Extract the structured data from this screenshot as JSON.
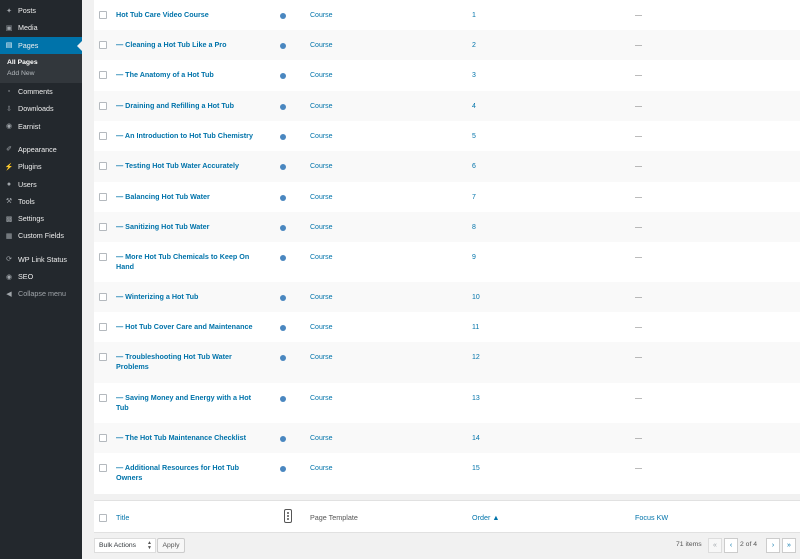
{
  "sidebar": {
    "items_top": [
      {
        "label": "Posts",
        "icon": "pin-icon"
      },
      {
        "label": "Media",
        "icon": "media-icon"
      },
      {
        "label": "Pages",
        "icon": "pages-icon"
      }
    ],
    "submenu": [
      {
        "label": "All Pages"
      },
      {
        "label": "Add New"
      }
    ],
    "items_mid": [
      {
        "label": "Comments",
        "icon": "comment-icon"
      },
      {
        "label": "Downloads",
        "icon": "download-icon"
      },
      {
        "label": "Earnist",
        "icon": "earnist-icon"
      }
    ],
    "items_bottom": [
      {
        "label": "Appearance",
        "icon": "brush-icon"
      },
      {
        "label": "Plugins",
        "icon": "plugin-icon"
      },
      {
        "label": "Users",
        "icon": "users-icon"
      },
      {
        "label": "Tools",
        "icon": "wrench-icon"
      },
      {
        "label": "Settings",
        "icon": "settings-icon"
      },
      {
        "label": "Custom Fields",
        "icon": "fields-icon"
      },
      {
        "label": "WP Link Status",
        "icon": "link-status-icon"
      },
      {
        "label": "SEO",
        "icon": "seo-icon"
      },
      {
        "label": "Collapse menu",
        "icon": "collapse-icon"
      }
    ]
  },
  "rows": [
    {
      "title": "Hot Tub Care Video Course",
      "template": "Course",
      "order": "1",
      "kw": "—"
    },
    {
      "title": "— Cleaning a Hot Tub Like a Pro",
      "template": "Course",
      "order": "2",
      "kw": "—"
    },
    {
      "title": "— The Anatomy of a Hot Tub",
      "template": "Course",
      "order": "3",
      "kw": "—"
    },
    {
      "title": "— Draining and Refilling a Hot Tub",
      "template": "Course",
      "order": "4",
      "kw": "—"
    },
    {
      "title": "— An Introduction to Hot Tub Chemistry",
      "template": "Course",
      "order": "5",
      "kw": "—"
    },
    {
      "title": "— Testing Hot Tub Water Accurately",
      "template": "Course",
      "order": "6",
      "kw": "—"
    },
    {
      "title": "— Balancing Hot Tub Water",
      "template": "Course",
      "order": "7",
      "kw": "—"
    },
    {
      "title": "— Sanitizing Hot Tub Water",
      "template": "Course",
      "order": "8",
      "kw": "—"
    },
    {
      "title": "— More Hot Tub Chemicals to Keep On Hand",
      "template": "Course",
      "order": "9",
      "kw": "—"
    },
    {
      "title": "— Winterizing a Hot Tub",
      "template": "Course",
      "order": "10",
      "kw": "—"
    },
    {
      "title": "— Hot Tub Cover Care and Maintenance",
      "template": "Course",
      "order": "11",
      "kw": "—"
    },
    {
      "title": "— Troubleshooting Hot Tub Water Problems",
      "template": "Course",
      "order": "12",
      "kw": "—"
    },
    {
      "title": "— Saving Money and Energy with a Hot Tub",
      "template": "Course",
      "order": "13",
      "kw": "—"
    },
    {
      "title": "— The Hot Tub Maintenance Checklist",
      "template": "Course",
      "order": "14",
      "kw": "—"
    },
    {
      "title": "— Additional Resources for Hot Tub Owners",
      "template": "Course",
      "order": "15",
      "kw": "—"
    }
  ],
  "footer_header": {
    "title": "Title",
    "page_template": "Page Template",
    "order": "Order ▲",
    "focus_kw": "Focus KW"
  },
  "bottom": {
    "bulk_actions": "Bulk Actions",
    "apply": "Apply",
    "items": "71 items",
    "first": "«",
    "prev": "‹",
    "page": "2 of 4",
    "next": "›",
    "last": "»"
  },
  "colors": {
    "sidebar_bg": "#23282d",
    "accent": "#0073aa"
  }
}
